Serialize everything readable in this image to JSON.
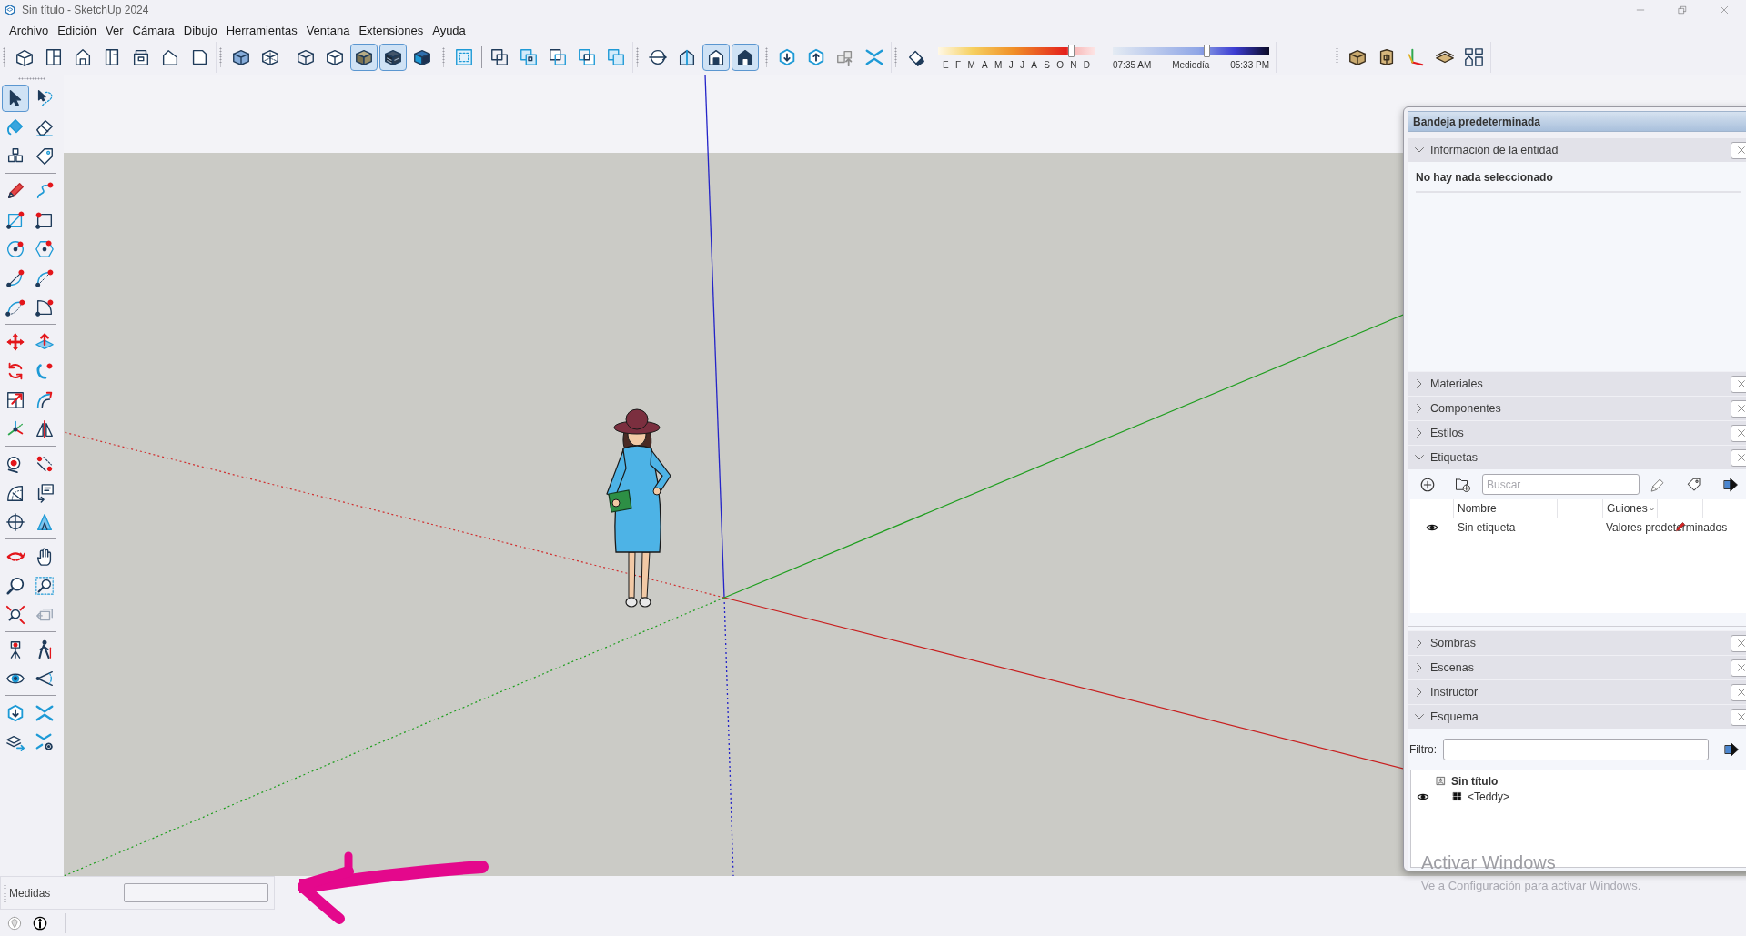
{
  "window": {
    "title": "Sin título - SketchUp 2024"
  },
  "menu": [
    "Archivo",
    "Edición",
    "Ver",
    "Cámara",
    "Dibujo",
    "Herramientas",
    "Ventana",
    "Extensiones",
    "Ayuda"
  ],
  "toolbar": {
    "groups": [
      {
        "buttons": [
          {
            "on": false
          },
          {
            "on": false
          },
          {
            "on": false
          },
          {
            "on": false
          },
          {
            "on": false
          },
          {
            "on": false
          },
          {
            "on": false
          }
        ]
      },
      {
        "buttons": [
          {
            "on": false
          },
          {
            "on": false
          },
          {
            "on": false
          },
          {
            "on": false
          },
          {
            "on": true
          },
          {
            "on": true
          },
          {
            "on": false
          }
        ]
      },
      {
        "buttons": [
          {
            "on": false
          },
          {
            "on": false
          },
          {
            "on": false
          },
          {
            "on": false
          },
          {
            "on": false
          },
          {
            "on": false
          }
        ]
      },
      {
        "buttons": [
          {
            "on": false
          },
          {
            "on": false
          },
          {
            "on": true
          },
          {
            "on": true
          }
        ]
      },
      {
        "buttons": [
          {
            "on": false
          },
          {
            "on": false
          },
          {
            "on": false
          },
          {
            "on": false
          }
        ]
      }
    ]
  },
  "shadow_toolbar": {
    "toggle": {
      "on": false
    },
    "month_slider": {
      "level": 0.85,
      "labels": [
        "E",
        "F",
        "M",
        "A",
        "M",
        "J",
        "J",
        "A",
        "S",
        "O",
        "N",
        "D"
      ]
    },
    "time_slider": {
      "level": 0.6,
      "labels": [
        "07:35 AM",
        "Mediodía",
        "05:33 PM"
      ]
    }
  },
  "toolbar_right": {
    "buttons": [
      {
        "on": false
      },
      {
        "on": false
      },
      {
        "on": false
      },
      {
        "on": false
      },
      {
        "on": false
      }
    ]
  },
  "tool_palette": {
    "groups": [
      {
        "tools": [
          {
            "selected": true,
            "disabled": false
          },
          {
            "selected": false,
            "disabled": false
          },
          {
            "selected": false,
            "disabled": false
          },
          {
            "selected": false,
            "disabled": false
          },
          {
            "selected": false,
            "disabled": false
          },
          {
            "selected": false,
            "disabled": false
          }
        ]
      },
      {
        "tools": [
          {
            "selected": false,
            "disabled": false
          },
          {
            "selected": false,
            "disabled": false
          },
          {
            "selected": false,
            "disabled": false
          },
          {
            "selected": false,
            "disabled": false
          },
          {
            "selected": false,
            "disabled": false
          },
          {
            "selected": false,
            "disabled": false
          },
          {
            "selected": false,
            "disabled": false
          },
          {
            "selected": false,
            "disabled": false
          },
          {
            "selected": false,
            "disabled": false
          },
          {
            "selected": false,
            "disabled": false
          }
        ]
      },
      {
        "tools": [
          {
            "selected": false,
            "disabled": false
          },
          {
            "selected": false,
            "disabled": false
          },
          {
            "selected": false,
            "disabled": false
          },
          {
            "selected": false,
            "disabled": false
          },
          {
            "selected": false,
            "disabled": false
          },
          {
            "selected": false,
            "disabled": false
          },
          {
            "selected": false,
            "disabled": false
          },
          {
            "selected": false,
            "disabled": false
          }
        ]
      },
      {
        "tools": [
          {
            "selected": false,
            "disabled": false
          },
          {
            "selected": false,
            "disabled": false
          },
          {
            "selected": false,
            "disabled": false
          },
          {
            "selected": false,
            "disabled": false
          },
          {
            "selected": false,
            "disabled": false
          },
          {
            "selected": false,
            "disabled": false
          }
        ]
      },
      {
        "tools": [
          {
            "selected": false,
            "disabled": false
          },
          {
            "selected": false,
            "disabled": false
          },
          {
            "selected": false,
            "disabled": false
          },
          {
            "selected": false,
            "disabled": false
          },
          {
            "selected": false,
            "disabled": false
          },
          {
            "selected": false,
            "disabled": true
          }
        ]
      },
      {
        "tools": [
          {
            "selected": false,
            "disabled": false
          },
          {
            "selected": false,
            "disabled": false
          },
          {
            "selected": false,
            "disabled": false
          },
          {
            "selected": false,
            "disabled": false
          }
        ]
      },
      {
        "tools": [
          {
            "selected": false,
            "disabled": false
          },
          {
            "selected": false,
            "disabled": false
          },
          {
            "selected": false,
            "disabled": false
          },
          {
            "selected": false,
            "disabled": false
          }
        ]
      }
    ]
  },
  "tray": {
    "title": "Bandeja predeterminada",
    "panels": [
      {
        "kind": "entity",
        "title": "Información de la entidad",
        "expanded": true,
        "message": "No hay nada seleccionado"
      },
      {
        "title": "Materiales",
        "expanded": false
      },
      {
        "title": "Componentes",
        "expanded": false
      },
      {
        "title": "Estilos",
        "expanded": false
      },
      {
        "kind": "tags",
        "title": "Etiquetas",
        "expanded": true,
        "search": {
          "placeholder": "Buscar"
        },
        "columns": [
          {
            "label": "Nombre",
            "dropdown": false
          },
          {
            "label": "Guiones",
            "dropdown": true
          }
        ],
        "rows": [
          {
            "visible": true,
            "name": "Sin etiqueta",
            "dashes": "Valores predeterminados"
          }
        ]
      },
      {
        "title": "Sombras",
        "expanded": false
      },
      {
        "title": "Escenas",
        "expanded": false
      },
      {
        "title": "Instructor",
        "expanded": false
      },
      {
        "kind": "outliner",
        "title": "Esquema",
        "expanded": true,
        "filter_label": "Filtro:",
        "tree": [
          {
            "kind": "model",
            "name": "Sin título",
            "children": [
              {
                "kind": "component",
                "name": "<Teddy>",
                "visible": true
              }
            ]
          }
        ]
      }
    ]
  },
  "measurements": {
    "label": "Medidas"
  },
  "windows_watermark": {
    "title": "Activar Windows",
    "text": "Ve a Configuración para activar Windows."
  }
}
